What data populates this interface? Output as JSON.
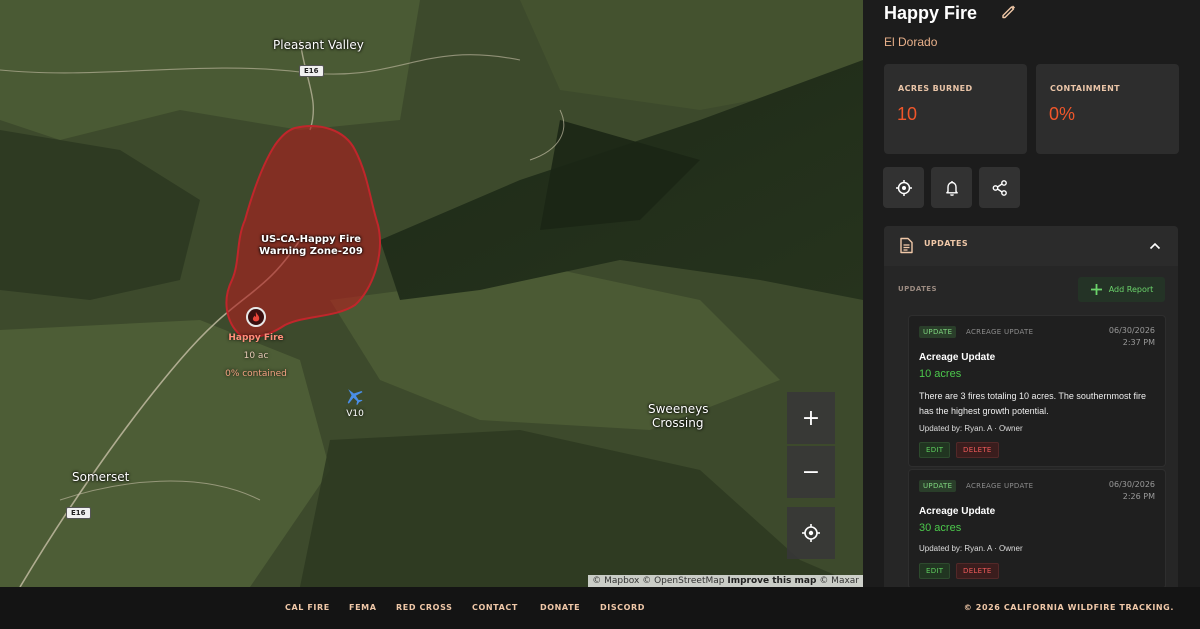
{
  "map": {
    "places": {
      "pleasant_valley": "Pleasant Valley",
      "somerset": "Somerset",
      "sweeneys_line1": "Sweeneys",
      "sweeneys_line2": "Crossing"
    },
    "road_shields": {
      "north": "E16",
      "south": "E16"
    },
    "zone": {
      "line1": "US-CA-Happy Fire",
      "line2": "Warning Zone-209"
    },
    "fire_marker": {
      "name": "Happy Fire",
      "acres": "10 ac",
      "contained": "0% contained"
    },
    "aircraft_label": "V10",
    "controls": {
      "zoom_in": "+",
      "zoom_out": "−"
    },
    "attribution": {
      "mapbox": "© Mapbox",
      "osm": "© OpenStreetMap",
      "improve": "Improve this map",
      "maxar": "© Maxar"
    },
    "colors": {
      "fire_perimeter": "#b01e1e"
    }
  },
  "panel": {
    "title": "Happy Fire",
    "county": "El Dorado",
    "stats": {
      "acres_label": "ACRES BURNED",
      "acres_value": "10",
      "containment_label": "CONTAINMENT",
      "containment_value": "0%"
    },
    "actions": [
      "target-icon",
      "bell-icon",
      "share-icon"
    ],
    "updates": {
      "header": "UPDATES",
      "sub_label": "UPDATES",
      "add_report": "Add Report",
      "reports": [
        {
          "badge": "UPDATE",
          "type": "ACREAGE UPDATE",
          "date": "06/30/2026",
          "time": "2:37 PM",
          "title": "Acreage Update",
          "acres": "10 acres",
          "description": "There are 3 fires totaling 10 acres. The southernmost fire has the highest growth potential.",
          "by": "Updated by: Ryan. A · Owner",
          "edit": "EDIT",
          "delete": "DELETE"
        },
        {
          "badge": "UPDATE",
          "type": "ACREAGE UPDATE",
          "date": "06/30/2026",
          "time": "2:26 PM",
          "title": "Acreage Update",
          "acres": "30 acres",
          "description": "",
          "by": "Updated by: Ryan. A · Owner",
          "edit": "EDIT",
          "delete": "DELETE"
        }
      ]
    },
    "colors": {
      "accent_orange": "#f0562a",
      "accent_green": "#4cc84c"
    }
  },
  "footer": {
    "links": [
      "CAL FIRE",
      "FEMA",
      "RED CROSS",
      "CONTACT",
      "DONATE",
      "DISCORD"
    ],
    "copyright": "© 2026 CALIFORNIA WILDFIRE TRACKING."
  }
}
